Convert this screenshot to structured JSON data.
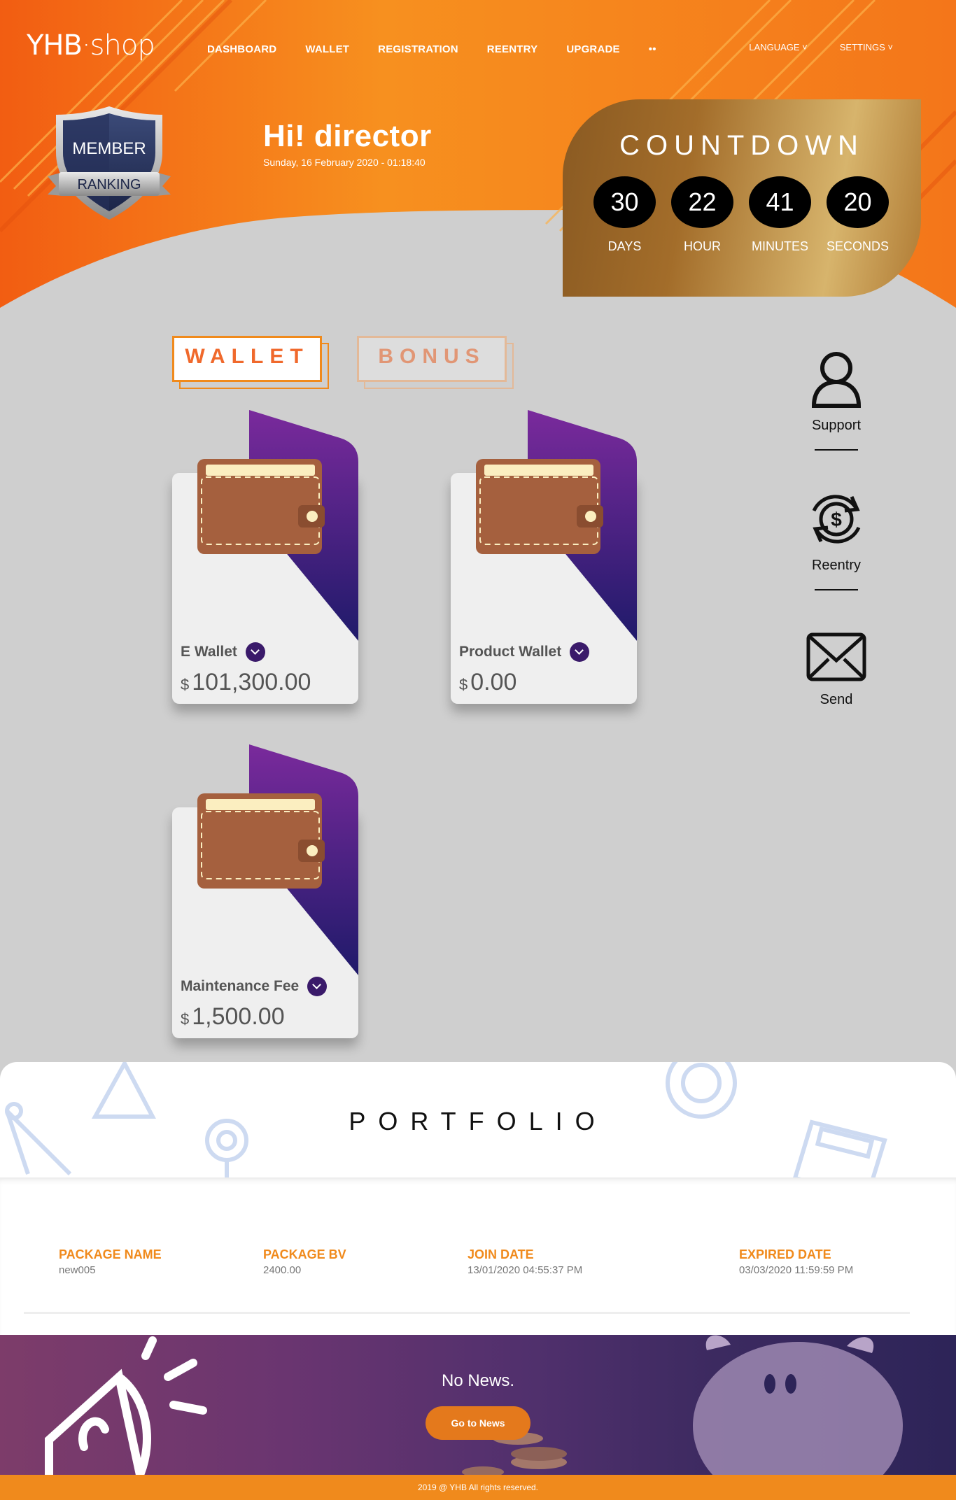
{
  "logo": {
    "brand": "YHB",
    "suffix": "shop"
  },
  "nav": {
    "items": [
      "DASHBOARD",
      "WALLET",
      "REGISTRATION",
      "REENTRY",
      "UPGRADE",
      "••"
    ],
    "language": "LANGUAGE",
    "settings": "SETTINGS"
  },
  "badge": {
    "line1": "MEMBER",
    "line2": "RANKING"
  },
  "greeting": {
    "title": "Hi!  director",
    "datetime": "Sunday, 16 February 2020 - 01:18:40"
  },
  "countdown": {
    "title": "COUNTDOWN",
    "items": [
      {
        "value": "30",
        "label": "DAYS"
      },
      {
        "value": "22",
        "label": "HOUR"
      },
      {
        "value": "41",
        "label": "MINUTES"
      },
      {
        "value": "20",
        "label": "SECONDS"
      }
    ]
  },
  "tabs": {
    "wallet": "WALLET",
    "bonus": "BONUS"
  },
  "wallets": [
    {
      "name": "E Wallet",
      "currency": "$",
      "amount": "101,300.00"
    },
    {
      "name": "Product Wallet",
      "currency": "$",
      "amount": "0.00"
    },
    {
      "name": "Maintenance Fee",
      "currency": "$",
      "amount": "1,500.00"
    }
  ],
  "side_actions": {
    "support": "Support",
    "reentry": "Reentry",
    "send": "Send"
  },
  "portfolio": {
    "title": "PORTFOLIO",
    "columns": [
      {
        "header": "PACKAGE NAME",
        "value": "new005"
      },
      {
        "header": "PACKAGE BV",
        "value": "2400.00"
      },
      {
        "header": "JOIN DATE",
        "value": "13/01/2020 04:55:37 PM"
      },
      {
        "header": "EXPIRED DATE",
        "value": "03/03/2020 11:59:59 PM"
      }
    ]
  },
  "news": {
    "message": "No News.",
    "button": "Go to News"
  },
  "footer": {
    "copyright": "2019 @ YHB All rights reserved."
  },
  "colors": {
    "orange": "#f08a1c",
    "purple": "#3a1a6a",
    "gold": "#b07b34"
  }
}
